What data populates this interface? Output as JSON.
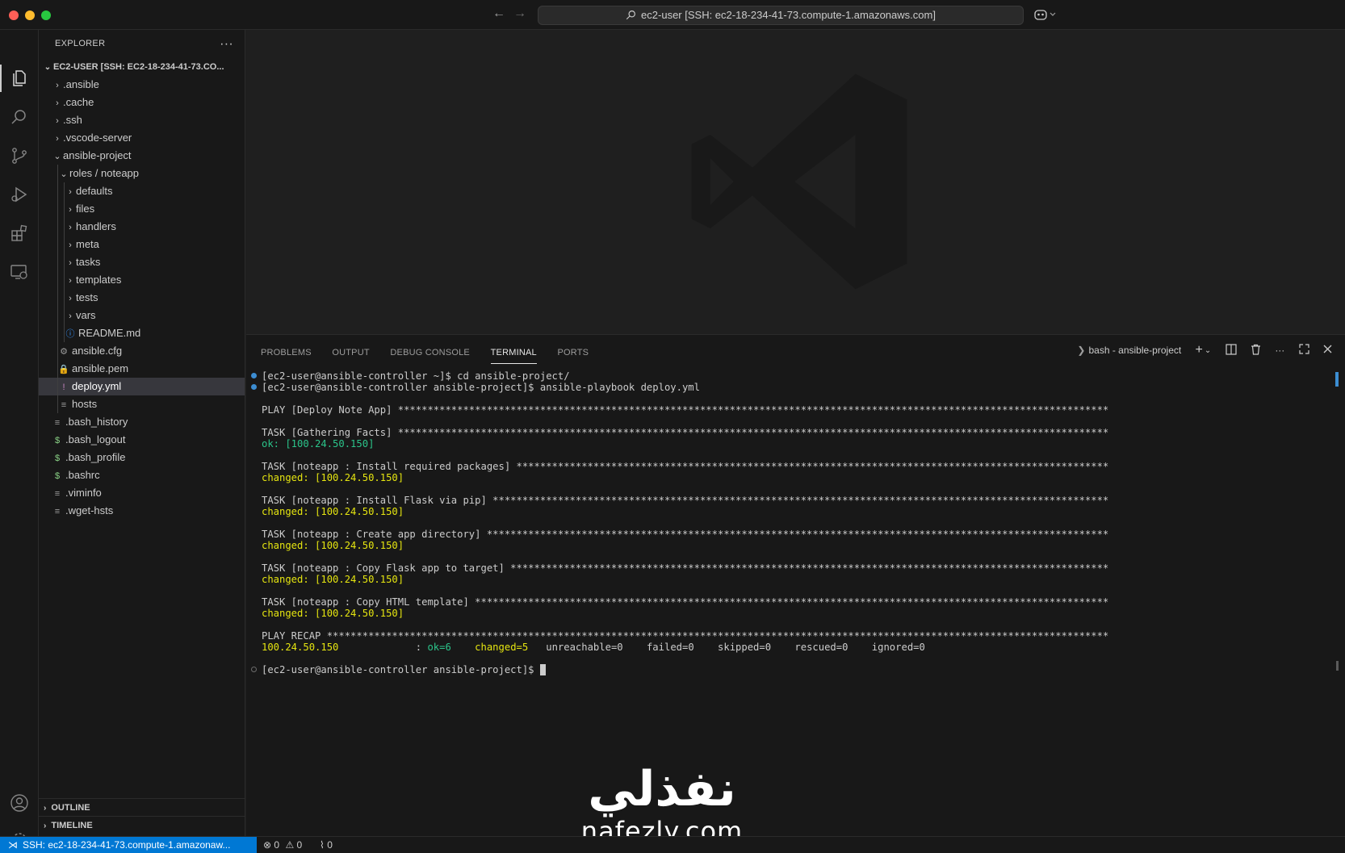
{
  "titlebar": {
    "command_center": "ec2-user [SSH: ec2-18-234-41-73.compute-1.amazonaws.com]",
    "back_icon": "arrow-left-icon",
    "forward_icon": "arrow-right-icon"
  },
  "activity_bar": [
    "explorer-icon",
    "search-icon",
    "source-control-icon",
    "run-debug-icon",
    "extensions-icon",
    "remote-explorer-icon",
    "account-icon",
    "gear-icon"
  ],
  "sidebar": {
    "title": "EXPLORER",
    "root": "EC2-USER [SSH: EC2-18-234-41-73.CO...",
    "items": [
      {
        "label": ".ansible",
        "kind": "folder"
      },
      {
        "label": ".cache",
        "kind": "folder"
      },
      {
        "label": ".ssh",
        "kind": "folder"
      },
      {
        "label": ".vscode-server",
        "kind": "folder"
      },
      {
        "label": "ansible-project",
        "kind": "folder-open"
      },
      {
        "label": "roles / noteapp",
        "kind": "folder-open"
      },
      {
        "label": "defaults",
        "kind": "folder"
      },
      {
        "label": "files",
        "kind": "folder"
      },
      {
        "label": "handlers",
        "kind": "folder"
      },
      {
        "label": "meta",
        "kind": "folder"
      },
      {
        "label": "tasks",
        "kind": "folder"
      },
      {
        "label": "templates",
        "kind": "folder"
      },
      {
        "label": "tests",
        "kind": "folder"
      },
      {
        "label": "vars",
        "kind": "folder"
      },
      {
        "label": "README.md",
        "kind": "info-file"
      },
      {
        "label": "ansible.cfg",
        "kind": "gear-file"
      },
      {
        "label": "ansible.pem",
        "kind": "lock-file"
      },
      {
        "label": "deploy.yml",
        "kind": "yaml-file"
      },
      {
        "label": "hosts",
        "kind": "text-file"
      },
      {
        "label": ".bash_history",
        "kind": "text-file"
      },
      {
        "label": ".bash_logout",
        "kind": "shell-file"
      },
      {
        "label": ".bash_profile",
        "kind": "shell-file"
      },
      {
        "label": ".bashrc",
        "kind": "shell-file"
      },
      {
        "label": ".viminfo",
        "kind": "text-file"
      },
      {
        "label": ".wget-hsts",
        "kind": "text-file"
      }
    ],
    "outline": "OUTLINE",
    "timeline": "TIMELINE"
  },
  "panel": {
    "tabs": [
      "PROBLEMS",
      "OUTPUT",
      "DEBUG CONSOLE",
      "TERMINAL",
      "PORTS"
    ],
    "active_tab": "TERMINAL",
    "terminal_name": "bash - ansible-project"
  },
  "terminal": {
    "cmd1": "[ec2-user@ansible-controller ~]$ cd ansible-project/",
    "cmd2": "[ec2-user@ansible-controller ansible-project]$ ansible-playbook deploy.yml",
    "play": "PLAY [Deploy Note App] ************************************************************************************************************************",
    "task_facts": "TASK [Gathering Facts] ************************************************************************************************************************",
    "ok_facts": "ok: [100.24.50.150]",
    "task1": "TASK [noteapp : Install required packages] ****************************************************************************************************",
    "task2": "TASK [noteapp : Install Flask via pip] ********************************************************************************************************",
    "task3": "TASK [noteapp : Create app directory] *********************************************************************************************************",
    "task4": "TASK [noteapp : Copy Flask app to target] *****************************************************************************************************",
    "task5": "TASK [noteapp : Copy HTML template] ***********************************************************************************************************",
    "changed": "changed: [100.24.50.150]",
    "recap": "PLAY RECAP ************************************************************************************************************************************",
    "recap_host": "100.24.50.150",
    "recap_colon": "             : ",
    "recap_ok": "ok=6",
    "recap_changed": "changed=5",
    "recap_rest": "   unreachable=0    failed=0    skipped=0    rescued=0    ignored=0",
    "prompt": "[ec2-user@ansible-controller ansible-project]$ "
  },
  "watermark": {
    "arabic": "نفذلي",
    "latin": "nafezly.com"
  },
  "statusbar": {
    "remote": "SSH: ec2-18-234-41-73.compute-1.amazonaw...",
    "errors": "0",
    "warnings": "0",
    "ports": "0"
  },
  "colors": {
    "accent": "#0078d4",
    "ok_green": "#2bc48a",
    "changed_yellow": "#e5e510"
  }
}
